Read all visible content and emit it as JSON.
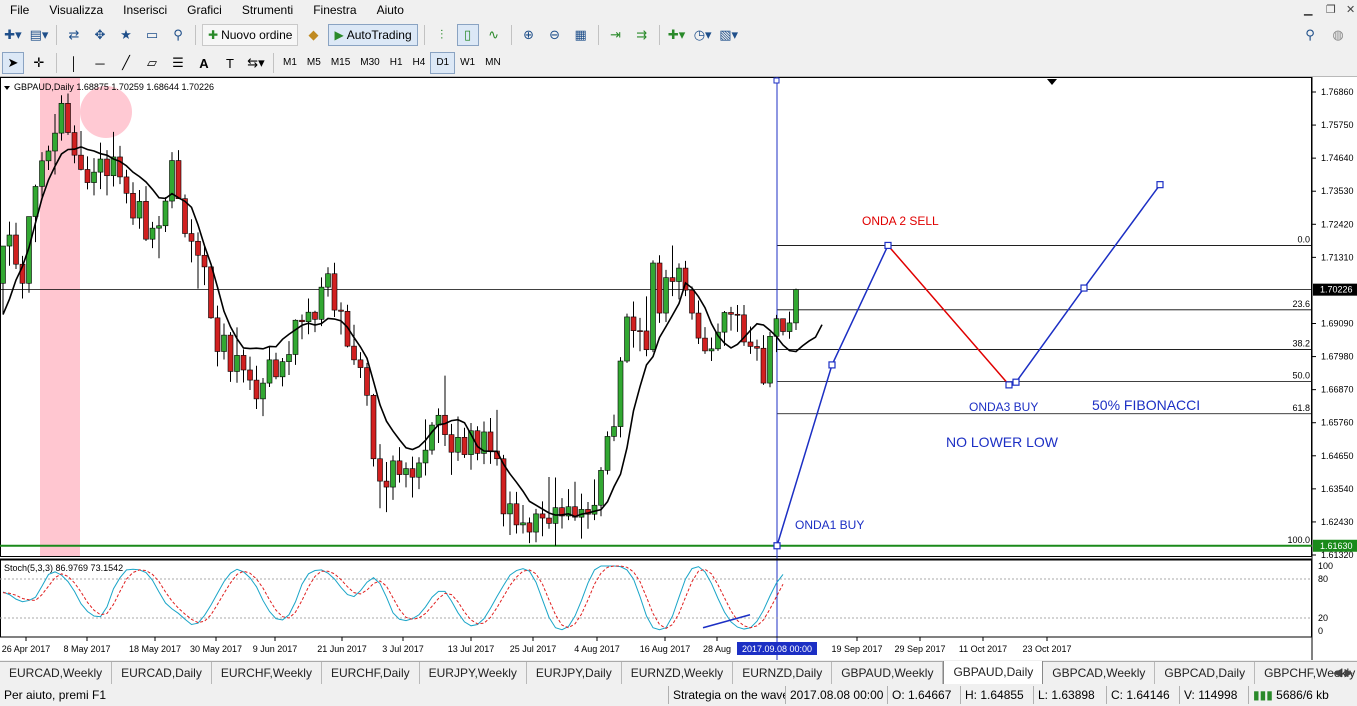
{
  "menu": [
    "File",
    "Visualizza",
    "Inserisci",
    "Grafici",
    "Strumenti",
    "Finestra",
    "Aiuto"
  ],
  "toolbar": {
    "new_order": "Nuovo ordine",
    "autotrading": "AutoTrading"
  },
  "timeframes": [
    "M1",
    "M5",
    "M15",
    "M30",
    "H1",
    "H4",
    "D1",
    "W1",
    "MN"
  ],
  "active_timeframe": "D1",
  "chart": {
    "header": "GBPAUD,Daily  1.68875 1.70259 1.68644 1.70226",
    "current_price_label": "1.70226",
    "support_label": "1.61630",
    "price_axis": [
      {
        "y": 1.7686,
        "label": "1.76860"
      },
      {
        "y": 1.7575,
        "label": "1.75750"
      },
      {
        "y": 1.7464,
        "label": "1.74640"
      },
      {
        "y": 1.7353,
        "label": "1.73530"
      },
      {
        "y": 1.7242,
        "label": "1.72420"
      },
      {
        "y": 1.7131,
        "label": "1.71310"
      },
      {
        "y": 1.6909,
        "label": "1.69090"
      },
      {
        "y": 1.6798,
        "label": "1.67980"
      },
      {
        "y": 1.6687,
        "label": "1.66870"
      },
      {
        "y": 1.6576,
        "label": "1.65760"
      },
      {
        "y": 1.6465,
        "label": "1.64650"
      },
      {
        "y": 1.6354,
        "label": "1.63540"
      },
      {
        "y": 1.6243,
        "label": "1.62430"
      },
      {
        "y": 1.6132,
        "label": "1.61320"
      }
    ],
    "date_axis": [
      "26 Apr 2017",
      "8 May 2017",
      "18 May 2017",
      "30 May 2017",
      "9 Jun 2017",
      "21 Jun 2017",
      "3 Jul 2017",
      "13 Jul 2017",
      "25 Jul 2017",
      "4 Aug 2017",
      "16 Aug 2017",
      "28 Aug",
      "19 Sep 2017",
      "29 Sep 2017",
      "11 Oct 2017",
      "23 Oct 2017"
    ],
    "crosshair_date": "2017.09.08 00:00",
    "fibonacci": [
      {
        "level": "0.0",
        "price": 1.7171
      },
      {
        "level": "23.6",
        "price": 1.6955
      },
      {
        "level": "38.2",
        "price": 1.6822
      },
      {
        "level": "50.0",
        "price": 1.6714
      },
      {
        "level": "61.8",
        "price": 1.6606
      },
      {
        "level": "100.0",
        "price": 1.6163
      }
    ],
    "annotations": {
      "onda1": "ONDA1 BUY",
      "onda2": "ONDA 2 SELL",
      "onda3": "ONDA3  BUY",
      "fib50": "50% FIBONACCI",
      "nolow": "NO LOWER LOW"
    },
    "stoch": {
      "label": "Stoch(5,3,3) 86.9769 73.1542",
      "levels": [
        "100",
        "80",
        "20",
        "0"
      ]
    },
    "colors": {
      "bull": "#32a832",
      "bear": "#d12020",
      "wave": "#1c2fc4",
      "sell": "#e00000",
      "highlight": "#ffc0cb"
    }
  },
  "chart_data": {
    "type": "candlestick",
    "series": [
      {
        "name": "GBPAUD,Daily",
        "ohlc": [
          [
            1.7044,
            1.7169,
            1.6939,
            1.7169
          ],
          [
            1.7169,
            1.7251,
            1.7103,
            1.7206
          ],
          [
            1.7206,
            1.7247,
            1.7092,
            1.7108
          ],
          [
            1.7108,
            1.7136,
            1.6993,
            1.7044
          ],
          [
            1.7044,
            1.7268,
            1.7012,
            1.7268
          ],
          [
            1.7268,
            1.7375,
            1.7182,
            1.7369
          ],
          [
            1.7369,
            1.7484,
            1.7329,
            1.7455
          ],
          [
            1.7455,
            1.7506,
            1.7424,
            1.7488
          ],
          [
            1.7488,
            1.7612,
            1.7409,
            1.7548
          ],
          [
            1.7548,
            1.7675,
            1.7523,
            1.7648
          ],
          [
            1.7648,
            1.7681,
            1.7542,
            1.755
          ],
          [
            1.755,
            1.7574,
            1.7447,
            1.7474
          ],
          [
            1.7474,
            1.7555,
            1.7423,
            1.7426
          ],
          [
            1.7426,
            1.747,
            1.7359,
            1.7382
          ],
          [
            1.7382,
            1.7464,
            1.7339,
            1.7417
          ],
          [
            1.7417,
            1.7516,
            1.736,
            1.7461
          ],
          [
            1.7461,
            1.7491,
            1.7339,
            1.7405
          ],
          [
            1.7405,
            1.7552,
            1.7369,
            1.7468
          ],
          [
            1.7468,
            1.7505,
            1.7377,
            1.7401
          ],
          [
            1.7401,
            1.7425,
            1.7312,
            1.7346
          ],
          [
            1.7346,
            1.7383,
            1.724,
            1.7263
          ],
          [
            1.7263,
            1.7357,
            1.7227,
            1.7319
          ],
          [
            1.7319,
            1.737,
            1.7186,
            1.7192
          ],
          [
            1.7192,
            1.725,
            1.7162,
            1.7229
          ],
          [
            1.7229,
            1.727,
            1.7128,
            1.7237
          ],
          [
            1.7237,
            1.7333,
            1.7216,
            1.732
          ],
          [
            1.732,
            1.7484,
            1.7296,
            1.7456
          ],
          [
            1.7456,
            1.7491,
            1.7328,
            1.7328
          ],
          [
            1.7328,
            1.7342,
            1.7198,
            1.7211
          ],
          [
            1.7211,
            1.7259,
            1.7114,
            1.7185
          ],
          [
            1.7185,
            1.7215,
            1.7026,
            1.7138
          ],
          [
            1.7138,
            1.7174,
            1.7038,
            1.7099
          ],
          [
            1.7099,
            1.7101,
            1.6925,
            1.6928
          ],
          [
            1.6928,
            1.6969,
            1.6765,
            1.6815
          ],
          [
            1.6815,
            1.6909,
            1.6788,
            1.687
          ],
          [
            1.687,
            1.688,
            1.6713,
            1.6748
          ],
          [
            1.6748,
            1.6896,
            1.671,
            1.6802
          ],
          [
            1.6802,
            1.6822,
            1.6711,
            1.6753
          ],
          [
            1.6753,
            1.6798,
            1.6686,
            1.6719
          ],
          [
            1.6719,
            1.6767,
            1.6622,
            1.6656
          ],
          [
            1.6656,
            1.6726,
            1.6598,
            1.6709
          ],
          [
            1.6709,
            1.6831,
            1.6696,
            1.6787
          ],
          [
            1.6787,
            1.6811,
            1.6722,
            1.673
          ],
          [
            1.673,
            1.6793,
            1.6698,
            1.6781
          ],
          [
            1.6781,
            1.685,
            1.6736,
            1.6805
          ],
          [
            1.6805,
            1.6923,
            1.677,
            1.692
          ],
          [
            1.692,
            1.6939,
            1.6856,
            1.6915
          ],
          [
            1.6915,
            1.6993,
            1.6873,
            1.6947
          ],
          [
            1.6947,
            1.6952,
            1.688,
            1.6923
          ],
          [
            1.6923,
            1.7064,
            1.69,
            1.7031
          ],
          [
            1.7031,
            1.7098,
            1.6999,
            1.7076
          ],
          [
            1.7076,
            1.7113,
            1.6931,
            1.6954
          ],
          [
            1.6954,
            1.698,
            1.6872,
            1.695
          ],
          [
            1.695,
            1.6972,
            1.6829,
            1.6833
          ],
          [
            1.6833,
            1.6905,
            1.677,
            1.6787
          ],
          [
            1.6787,
            1.6813,
            1.6726,
            1.6761
          ],
          [
            1.6761,
            1.6777,
            1.6633,
            1.6668
          ],
          [
            1.6668,
            1.6673,
            1.6429,
            1.6455
          ],
          [
            1.6455,
            1.6504,
            1.6289,
            1.638
          ],
          [
            1.638,
            1.6444,
            1.6276,
            1.636
          ],
          [
            1.636,
            1.6466,
            1.6317,
            1.6448
          ],
          [
            1.6448,
            1.6494,
            1.6375,
            1.6402
          ],
          [
            1.6402,
            1.6443,
            1.6359,
            1.6422
          ],
          [
            1.6422,
            1.6462,
            1.6325,
            1.6393
          ],
          [
            1.6393,
            1.646,
            1.6353,
            1.6441
          ],
          [
            1.6441,
            1.6587,
            1.6399,
            1.6484
          ],
          [
            1.6484,
            1.6578,
            1.6469,
            1.6568
          ],
          [
            1.6568,
            1.6624,
            1.6508,
            1.6601
          ],
          [
            1.6601,
            1.6734,
            1.6498,
            1.6536
          ],
          [
            1.6536,
            1.6572,
            1.6401,
            1.6477
          ],
          [
            1.6477,
            1.6597,
            1.6448,
            1.6527
          ],
          [
            1.6527,
            1.6559,
            1.6458,
            1.6469
          ],
          [
            1.6469,
            1.6575,
            1.6418,
            1.6549
          ],
          [
            1.6549,
            1.6564,
            1.645,
            1.6473
          ],
          [
            1.6473,
            1.658,
            1.6437,
            1.6545
          ],
          [
            1.6545,
            1.6592,
            1.6438,
            1.6481
          ],
          [
            1.6481,
            1.6619,
            1.6432,
            1.6455
          ],
          [
            1.6455,
            1.6468,
            1.6228,
            1.627
          ],
          [
            1.627,
            1.6345,
            1.6199,
            1.6304
          ],
          [
            1.6304,
            1.6344,
            1.6204,
            1.6233
          ],
          [
            1.6233,
            1.63,
            1.6204,
            1.624
          ],
          [
            1.624,
            1.6258,
            1.6172,
            1.6209
          ],
          [
            1.6209,
            1.6287,
            1.6175,
            1.627
          ],
          [
            1.627,
            1.6312,
            1.6195,
            1.6256
          ],
          [
            1.6256,
            1.6394,
            1.622,
            1.6238
          ],
          [
            1.6238,
            1.6392,
            1.6163,
            1.6291
          ],
          [
            1.6291,
            1.6323,
            1.6221,
            1.6263
          ],
          [
            1.6263,
            1.6353,
            1.6249,
            1.6294
          ],
          [
            1.6294,
            1.6378,
            1.6247,
            1.6259
          ],
          [
            1.6259,
            1.6338,
            1.6187,
            1.6285
          ],
          [
            1.6285,
            1.631,
            1.622,
            1.6269
          ],
          [
            1.6269,
            1.6386,
            1.6249,
            1.6299
          ],
          [
            1.6299,
            1.6427,
            1.6262,
            1.6416
          ],
          [
            1.6416,
            1.6547,
            1.6402,
            1.653
          ],
          [
            1.653,
            1.6603,
            1.6514,
            1.6563
          ],
          [
            1.6563,
            1.6796,
            1.6527,
            1.6783
          ],
          [
            1.6783,
            1.6942,
            1.6777,
            1.6931
          ],
          [
            1.6931,
            1.6983,
            1.6828,
            1.6885
          ],
          [
            1.6885,
            1.6928,
            1.6816,
            1.6884
          ],
          [
            1.6884,
            1.7,
            1.6799,
            1.6821
          ],
          [
            1.6821,
            1.7121,
            1.6813,
            1.7112
          ],
          [
            1.7112,
            1.7138,
            1.6911,
            1.6944
          ],
          [
            1.6944,
            1.7089,
            1.6914,
            1.7063
          ],
          [
            1.7063,
            1.7171,
            1.7001,
            1.705
          ],
          [
            1.705,
            1.7111,
            1.699,
            1.7095
          ],
          [
            1.7095,
            1.7119,
            1.7001,
            1.7021
          ],
          [
            1.7021,
            1.7033,
            1.6922,
            1.6944
          ],
          [
            1.6944,
            1.6986,
            1.684,
            1.686
          ],
          [
            1.686,
            1.6897,
            1.6807,
            1.6817
          ],
          [
            1.6817,
            1.6862,
            1.6783,
            1.6824
          ],
          [
            1.6824,
            1.6909,
            1.6817,
            1.688
          ],
          [
            1.688,
            1.6951,
            1.6834,
            1.6946
          ],
          [
            1.6946,
            1.6965,
            1.6885,
            1.694
          ],
          [
            1.694,
            1.6971,
            1.6881,
            1.6938
          ],
          [
            1.6938,
            1.6971,
            1.6834,
            1.6847
          ],
          [
            1.6847,
            1.6899,
            1.6807,
            1.6832
          ],
          [
            1.6832,
            1.6855,
            1.6784,
            1.6826
          ],
          [
            1.6826,
            1.687,
            1.6703,
            1.6709
          ],
          [
            1.6709,
            1.6881,
            1.6695,
            1.6866
          ],
          [
            1.6866,
            1.6938,
            1.6813,
            1.6925
          ],
          [
            1.6925,
            1.6925,
            1.6869,
            1.6882
          ],
          [
            1.6882,
            1.6949,
            1.6858,
            1.6911
          ],
          [
            1.6911,
            1.7026,
            1.6887,
            1.7023
          ]
        ]
      }
    ],
    "ma": [
      1.6939,
      1.6991,
      1.7055,
      1.7101,
      1.7164,
      1.7247,
      1.7329,
      1.7391,
      1.7437,
      1.7478,
      1.7493,
      1.7494,
      1.7502,
      1.7493,
      1.7488,
      1.7479,
      1.7474,
      1.7461,
      1.7453,
      1.7438,
      1.7417,
      1.7402,
      1.7384,
      1.7359,
      1.7331,
      1.7329,
      1.7345,
      1.7331,
      1.7319,
      1.7299,
      1.724,
      1.717,
      1.7108,
      1.7031,
      1.695,
      1.6898,
      1.6858,
      1.6827,
      1.6825,
      1.6826,
      1.6824,
      1.6832,
      1.6831,
      1.6856,
      1.6873,
      1.6888,
      1.6903,
      1.691,
      1.6904,
      1.6909,
      1.6926,
      1.6924,
      1.6918,
      1.6896,
      1.6862,
      1.683,
      1.6792,
      1.6715,
      1.6636,
      1.6581,
      1.6548,
      1.6519,
      1.6492,
      1.6486,
      1.6496,
      1.6517,
      1.6545,
      1.6569,
      1.6573,
      1.6583,
      1.6586,
      1.6576,
      1.6537,
      1.6496,
      1.6481,
      1.648,
      1.648,
      1.6437,
      1.6404,
      1.6376,
      1.6346,
      1.6312,
      1.6299,
      1.6286,
      1.6273,
      1.6266,
      1.6267,
      1.627,
      1.6261,
      1.6269,
      1.6273,
      1.6279,
      1.6284,
      1.6311,
      1.6361,
      1.6403,
      1.6492,
      1.6616,
      1.6697,
      1.677,
      1.6798,
      1.6862,
      1.6899,
      1.6937,
      1.6976,
      1.7045,
      1.7028,
      1.6999,
      1.6962,
      1.6908,
      1.6868,
      1.6843,
      1.6827,
      1.6839,
      1.6862,
      1.6886,
      1.6908,
      1.6904,
      1.6886,
      1.6865,
      1.6837,
      1.6818,
      1.6815,
      1.6834,
      1.685,
      1.6863,
      1.6905
    ],
    "stoch_k": [
      60,
      56,
      49,
      45,
      47,
      52,
      69,
      87,
      91,
      86,
      76,
      61,
      42,
      30,
      23,
      22,
      37,
      65,
      82,
      94,
      95,
      94,
      90,
      78,
      60,
      43,
      34,
      27,
      18,
      10,
      12,
      24,
      40,
      58,
      76,
      89,
      95,
      91,
      82,
      68,
      47,
      30,
      19,
      17,
      25,
      45,
      72,
      88,
      93,
      94,
      89,
      80,
      67,
      56,
      53,
      62,
      75,
      82,
      73,
      52,
      28,
      18,
      16,
      19,
      25,
      37,
      52,
      61,
      61,
      46,
      28,
      14,
      8,
      10,
      19,
      35,
      53,
      70,
      86,
      93,
      96,
      92,
      75,
      48,
      21,
      5,
      2,
      7,
      23,
      47,
      74,
      94,
      100,
      100,
      100,
      99,
      94,
      80,
      53,
      23,
      5,
      2,
      5,
      23,
      52,
      80,
      96,
      99,
      91,
      73,
      50,
      29,
      14,
      6,
      3,
      5,
      15,
      32,
      54,
      74,
      87
    ],
    "stoch_d": [
      59,
      58,
      55,
      50,
      48,
      47,
      56,
      69,
      82,
      88,
      84,
      74,
      60,
      44,
      32,
      25,
      27,
      41,
      61,
      80,
      90,
      94,
      93,
      87,
      76,
      60,
      46,
      35,
      26,
      18,
      13,
      15,
      25,
      41,
      58,
      74,
      87,
      92,
      89,
      80,
      66,
      48,
      32,
      22,
      20,
      29,
      47,
      68,
      84,
      92,
      92,
      88,
      79,
      68,
      59,
      57,
      63,
      73,
      77,
      69,
      51,
      33,
      21,
      18,
      20,
      27,
      38,
      50,
      58,
      56,
      45,
      29,
      17,
      11,
      12,
      21,
      36,
      53,
      70,
      83,
      92,
      94,
      88,
      72,
      48,
      25,
      9,
      5,
      11,
      26,
      48,
      72,
      89,
      98,
      100,
      100,
      98,
      91,
      76,
      52,
      27,
      10,
      4,
      10,
      27,
      52,
      76,
      92,
      95,
      88,
      71,
      51,
      31,
      16,
      8,
      5,
      8,
      17,
      34,
      53,
      72
    ]
  }
}
